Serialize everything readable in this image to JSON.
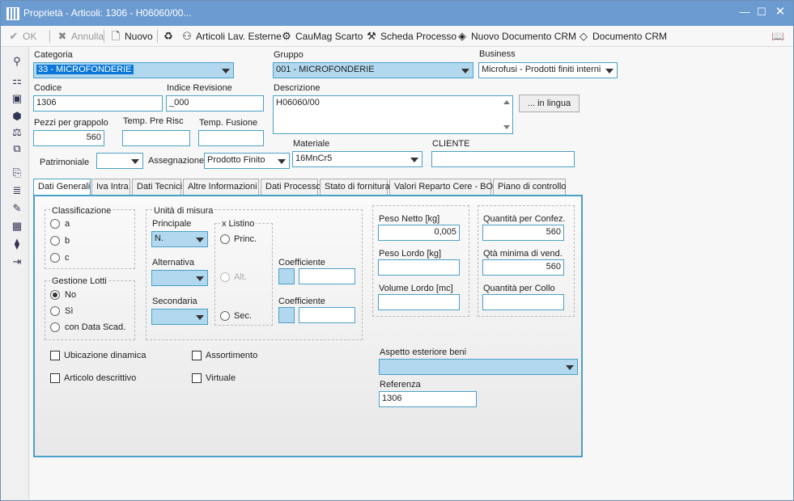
{
  "window": {
    "title": "Proprietà - Articoli: 1306 - H06060/00..."
  },
  "toolbar": {
    "ok": "OK",
    "annulla": "Annulla",
    "nuovo": "Nuovo",
    "articoli_lav_esterne": "Articoli Lav. Esterne",
    "caumag_scarto": "CauMag Scarto",
    "scheda_processo": "Scheda Processo",
    "nuovo_documento_crm": "Nuovo Documento CRM",
    "documento_crm": "Documento CRM"
  },
  "form": {
    "categoria_label": "Categoria",
    "categoria_value": "33 - MICROFONDERIE",
    "gruppo_label": "Gruppo",
    "gruppo_value": "001 - MICROFONDERIE",
    "business_label": "Business",
    "business_value": "Microfusi - Prodotti finiti interni",
    "codice_label": "Codice",
    "codice_value": "1306",
    "indice_revisione_label": "Indice Revisione",
    "indice_revisione_value": "_000",
    "descrizione_label": "Descrizione",
    "descrizione_value": "H06060/00",
    "in_lingua_button": "... in lingua",
    "pezzi_label": "Pezzi per grappolo",
    "pezzi_value": "560",
    "temp_pre_risc_label": "Temp. Pre Risc",
    "temp_pre_risc_value": "",
    "temp_fusione_label": "Temp. Fusione",
    "temp_fusione_value": "",
    "materiale_label": "Materiale",
    "materiale_value": "16MnCr5",
    "cliente_label": "CLIENTE",
    "cliente_value": "",
    "patrimoniale_label": "Patrimoniale",
    "patrimoniale_value": "",
    "assegnazione_label": "Assegnazione",
    "assegnazione_value": "Prodotto Finito"
  },
  "tabs": [
    "Dati Generali",
    "Iva Intra",
    "Dati Tecnici",
    "Altre Informazioni",
    "Dati Processo",
    "Stato di fornitura",
    "Valori Reparto Cere - BO",
    "Piano di controllo"
  ],
  "general": {
    "classificazione_title": "Classificazione",
    "class_a": "a",
    "class_b": "b",
    "class_c": "c",
    "gestione_lotti_title": "Gestione Lotti",
    "lotti_no": "No",
    "lotti_si": "Sì",
    "lotti_data": "con Data Scad.",
    "unita_title": "Unità di misura",
    "principale_label": "Principale",
    "principale_value": "N.",
    "alternativa_label": "Alternativa",
    "alternativa_value": "",
    "secondaria_label": "Secondaria",
    "secondaria_value": "",
    "listino_title": "x Listino",
    "listino_princ": "Princ.",
    "listino_alt": "Alt.",
    "listino_sec": "Sec.",
    "coefficiente_label_1": "Coefficiente",
    "coefficiente_label_2": "Coefficiente",
    "coefficiente_value_1": "",
    "coefficiente_value_2": "",
    "peso_netto_label": "Peso Netto [kg]",
    "peso_netto_value": "0,005",
    "peso_lordo_label": "Peso Lordo [kg]",
    "peso_lordo_value": "",
    "volume_lordo_label": "Volume Lordo [mc]",
    "volume_lordo_value": "",
    "qta_confez_label": "Quantità per Confez.",
    "qta_confez_value": "560",
    "qta_minima_label": "Qtà minima di vend.",
    "qta_minima_value": "560",
    "qta_collo_label": "Quantità per Collo",
    "qta_collo_value": "",
    "ubicazione_label": "Ubicazione dinamica",
    "assortimento_label": "Assortimento",
    "articolo_descrittivo_label": "Articolo descrittivo",
    "virtuale_label": "Virtuale",
    "aspetto_label": "Aspetto esteriore beni",
    "aspetto_value": "",
    "referenza_label": "Referenza",
    "referenza_value": "1306"
  },
  "icons": {
    "ok": "check-icon",
    "annulla": "x-icon",
    "nuovo": "new-doc-icon",
    "recycle": "recycle-icon",
    "articoli_lav": "hierarchy-icon",
    "caumag": "scrap-icon",
    "scheda": "process-icon",
    "nuovo_crm": "crm-new-icon",
    "crm": "crm-icon",
    "book": "book-icon"
  }
}
